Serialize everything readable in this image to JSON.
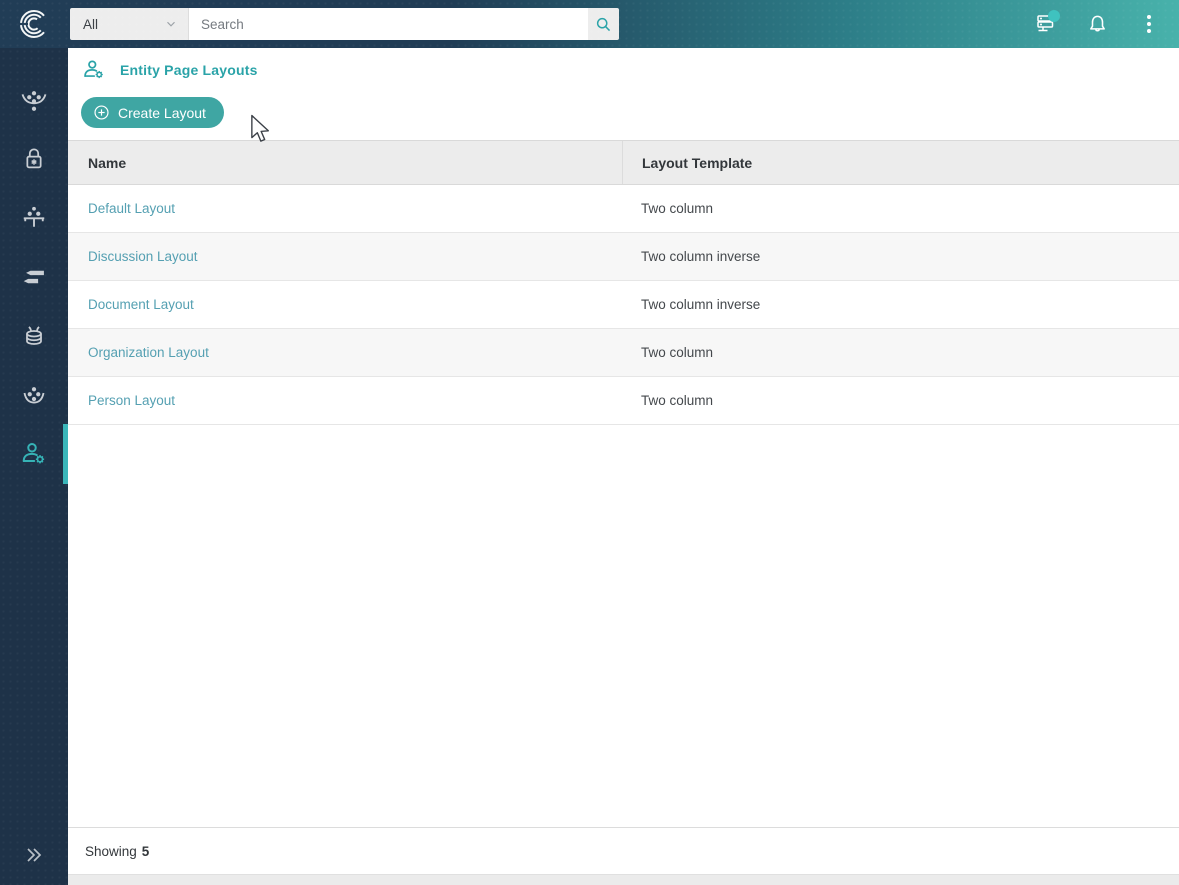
{
  "topbar": {
    "scope_value": "All",
    "search_placeholder": "Search",
    "icons": {
      "logo": "cluedin-c-logo",
      "right": [
        "server-status-icon",
        "bell-icon",
        "kebab-menu-icon"
      ]
    }
  },
  "sidebar": {
    "items": [
      {
        "icon": "funnel-dots-icon",
        "active": false
      },
      {
        "icon": "lock-star-icon",
        "active": false
      },
      {
        "icon": "table-dots-icon",
        "active": false
      },
      {
        "icon": "stream-arrows-icon",
        "active": false
      },
      {
        "icon": "database-icon",
        "active": false
      },
      {
        "icon": "network-dots-icon",
        "active": false
      },
      {
        "icon": "user-settings-icon",
        "active": true
      }
    ],
    "collapse_icon": "double-chevron-right-icon"
  },
  "page": {
    "title": "Entity Page Layouts",
    "title_icon": "user-settings-icon",
    "create_button_label": "Create Layout"
  },
  "table": {
    "columns": [
      "Name",
      "Layout Template"
    ],
    "rows": [
      {
        "name": "Default Layout",
        "template": "Two column"
      },
      {
        "name": "Discussion Layout",
        "template": "Two column inverse"
      },
      {
        "name": "Document Layout",
        "template": "Two column inverse"
      },
      {
        "name": "Organization Layout",
        "template": "Two column"
      },
      {
        "name": "Person Layout",
        "template": "Two column"
      }
    ]
  },
  "footer": {
    "showing_label": "Showing",
    "showing_count": "5"
  },
  "colors": {
    "topbar_navy": "#213d56",
    "topbar_teal": "#48b2ab",
    "sidebar_bg": "#1e3248",
    "accent_teal": "#3ab6ba",
    "title_teal": "#2aa3a8",
    "button_teal": "#3fa6a3",
    "link_color": "#55a0b2",
    "badge_teal": "#3fc2bf",
    "header_row_bg": "#ececec",
    "stripe_row_bg": "#f7f7f7"
  }
}
